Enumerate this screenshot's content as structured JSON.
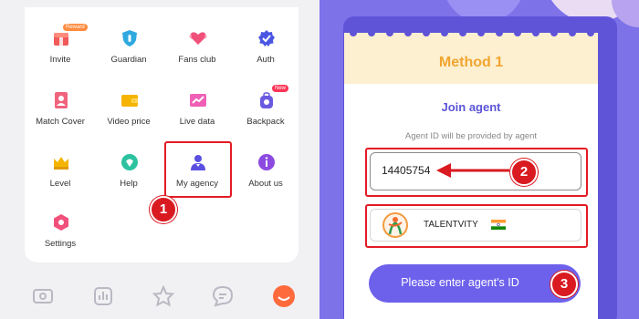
{
  "menu": {
    "items": [
      {
        "label": "Invite",
        "icon": "invite-icon",
        "badge": "Reward"
      },
      {
        "label": "Guardian",
        "icon": "guardian-shield-icon"
      },
      {
        "label": "Fans club",
        "icon": "heart-wings-icon"
      },
      {
        "label": "Auth",
        "icon": "verified-badge-icon"
      },
      {
        "label": "Match Cover",
        "icon": "portrait-icon"
      },
      {
        "label": "Video price",
        "icon": "wallet-icon"
      },
      {
        "label": "Live data",
        "icon": "chart-icon"
      },
      {
        "label": "Backpack",
        "icon": "backpack-icon",
        "badge": "New"
      },
      {
        "label": "Level",
        "icon": "crown-icon"
      },
      {
        "label": "Help",
        "icon": "help-icon"
      },
      {
        "label": "My agency",
        "icon": "agent-icon"
      },
      {
        "label": "About us",
        "icon": "info-icon"
      },
      {
        "label": "Settings",
        "icon": "settings-icon"
      }
    ]
  },
  "steps": {
    "one": "1",
    "two": "2",
    "three": "3"
  },
  "bottom_nav": [
    "video-icon",
    "ranking-icon",
    "star-icon",
    "message-icon",
    "profile-icon"
  ],
  "method": {
    "title": "Method 1",
    "heading": "Join agent",
    "hint": "Agent ID will be provided by agent",
    "agent_id_value": "14405754",
    "agent_name": "TALENTVITY",
    "button_label": "Please enter agent's ID"
  },
  "colors": {
    "accent": "#6d61ec",
    "highlight": "#e31b23",
    "method_title": "#f2a531"
  }
}
